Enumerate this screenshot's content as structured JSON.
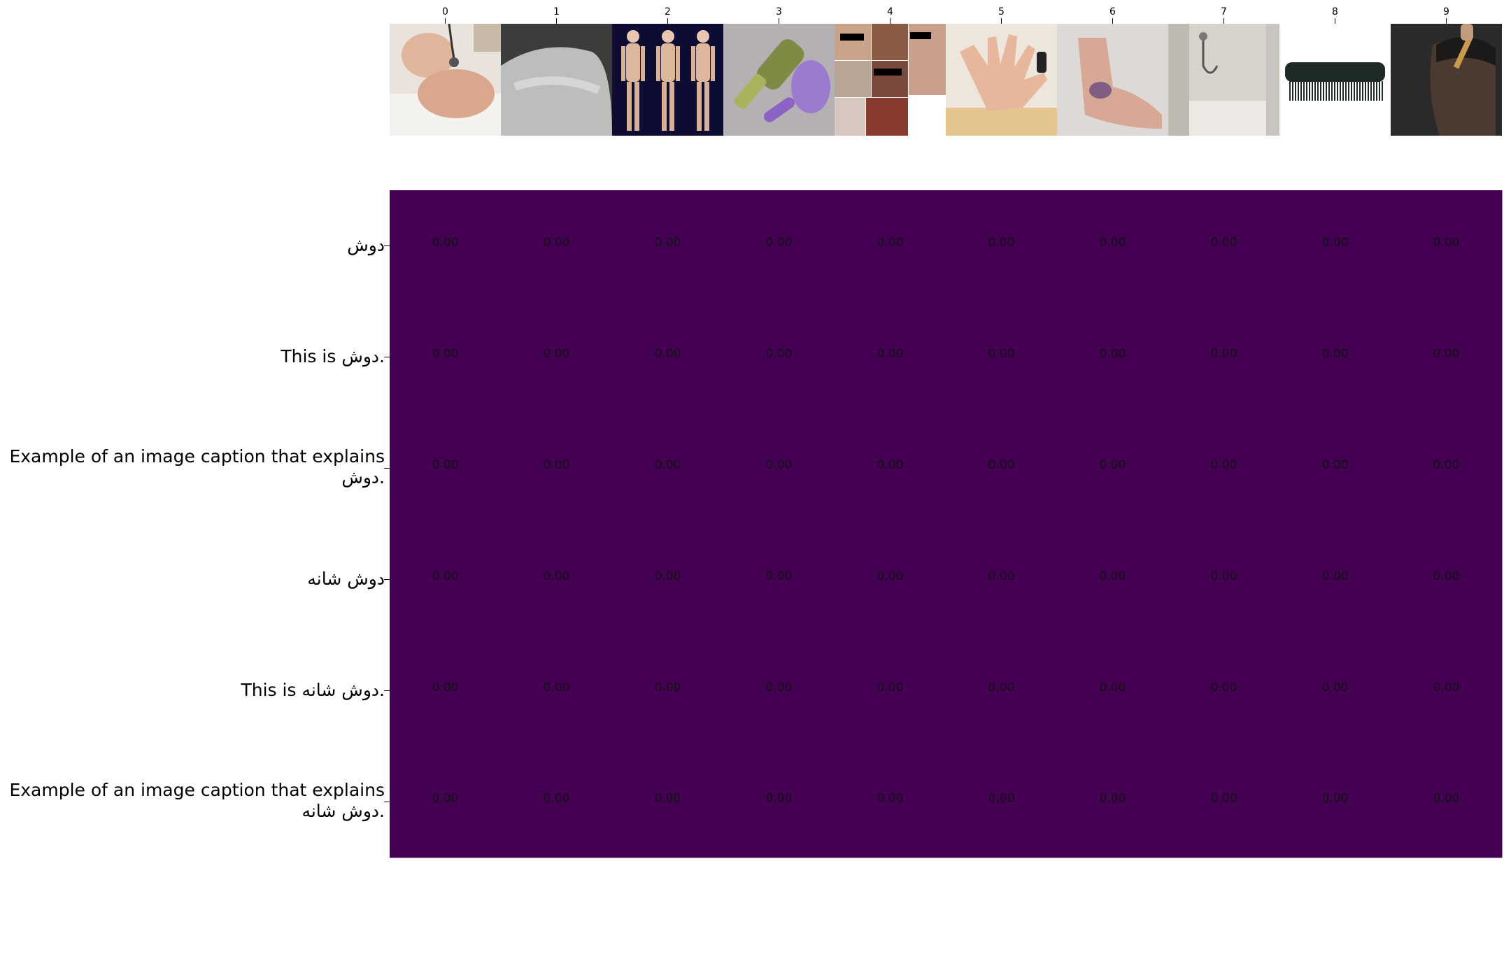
{
  "chart_data": {
    "type": "heatmap",
    "title": "",
    "xlabel": "",
    "ylabel": "",
    "x_ticks": [
      "0",
      "1",
      "2",
      "3",
      "4",
      "5",
      "6",
      "7",
      "8",
      "9"
    ],
    "y_labels": [
      "دوش",
      "This is دوش.",
      "Example of an image caption that explains دوش.",
      "دوش شانه",
      "This is دوش شانه.",
      "Example of an image caption that explains دوش شانه."
    ],
    "values": [
      [
        0,
        0,
        0,
        0,
        0,
        0,
        0,
        0,
        0,
        0
      ],
      [
        0,
        0,
        0,
        0,
        0,
        0,
        0,
        0,
        0,
        0
      ],
      [
        0,
        0,
        0,
        0,
        0,
        0,
        0,
        0,
        0,
        0
      ],
      [
        0,
        0,
        0,
        0,
        0,
        0,
        0,
        0,
        0,
        0
      ],
      [
        0,
        0,
        0,
        0,
        0,
        0,
        0,
        0,
        0,
        0
      ],
      [
        0,
        0,
        0,
        0,
        0,
        0,
        0,
        0,
        0,
        0
      ]
    ],
    "value_labels": [
      [
        "0.00",
        "0.00",
        "0.00",
        "0.00",
        "0.00",
        "0.00",
        "0.00",
        "0.00",
        "0.00",
        "0.00"
      ],
      [
        "0.00",
        "0.00",
        "0.00",
        "0.00",
        "0.00",
        "0.00",
        "0.00",
        "0.00",
        "0.00",
        "0.00"
      ],
      [
        "0.00",
        "0.00",
        "0.00",
        "0.00",
        "0.00",
        "0.00",
        "0.00",
        "0.00",
        "0.00",
        "0.00"
      ],
      [
        "0.00",
        "0.00",
        "0.00",
        "0.00",
        "0.00",
        "0.00",
        "0.00",
        "0.00",
        "0.00",
        "0.00"
      ],
      [
        "0.00",
        "0.00",
        "0.00",
        "0.00",
        "0.00",
        "0.00",
        "0.00",
        "0.00",
        "0.00",
        "0.00"
      ],
      [
        "0.00",
        "0.00",
        "0.00",
        "0.00",
        "0.00",
        "0.00",
        "0.00",
        "0.00",
        "0.00",
        "0.00"
      ]
    ],
    "colormap": "viridis",
    "cell_color": "#440154",
    "column_images": [
      "newborn-baby-with-stethoscope",
      "bare-shoulder-grayscale",
      "skeleton-anatomy-figures",
      "hair-brushes",
      "medical-photo-collage",
      "open-palm-hand",
      "bruised-foot",
      "shower-stall",
      "black-comb",
      "man-combing-hair"
    ]
  }
}
